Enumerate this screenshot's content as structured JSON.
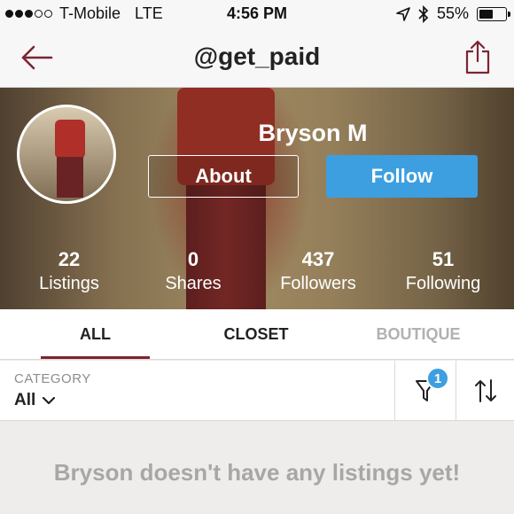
{
  "status_bar": {
    "carrier": "T-Mobile",
    "network": "LTE",
    "time": "4:56 PM",
    "battery": "55%",
    "battery_level": 0.55,
    "signal_bars_filled": 3,
    "signal_bars_total": 5
  },
  "nav": {
    "title": "@get_paid",
    "back_icon": "back-arrow-icon",
    "share_icon": "share-icon",
    "accent_color": "#7d2432"
  },
  "profile": {
    "name": "Bryson M",
    "about_label": "About",
    "follow_label": "Follow",
    "follow_color": "#3d9fe0",
    "stats": [
      {
        "value": "22",
        "label": "Listings"
      },
      {
        "value": "0",
        "label": "Shares"
      },
      {
        "value": "437",
        "label": "Followers"
      },
      {
        "value": "51",
        "label": "Following"
      }
    ]
  },
  "tabs": [
    {
      "label": "ALL",
      "active": true
    },
    {
      "label": "CLOSET",
      "active": false
    },
    {
      "label": "BOUTIQUE",
      "active": false
    }
  ],
  "filter": {
    "category_label": "CATEGORY",
    "category_value": "All",
    "filter_count": "1",
    "filter_icon": "filter-funnel-icon",
    "sort_icon": "sort-arrows-icon"
  },
  "empty_message": "Bryson doesn't have any listings yet!"
}
